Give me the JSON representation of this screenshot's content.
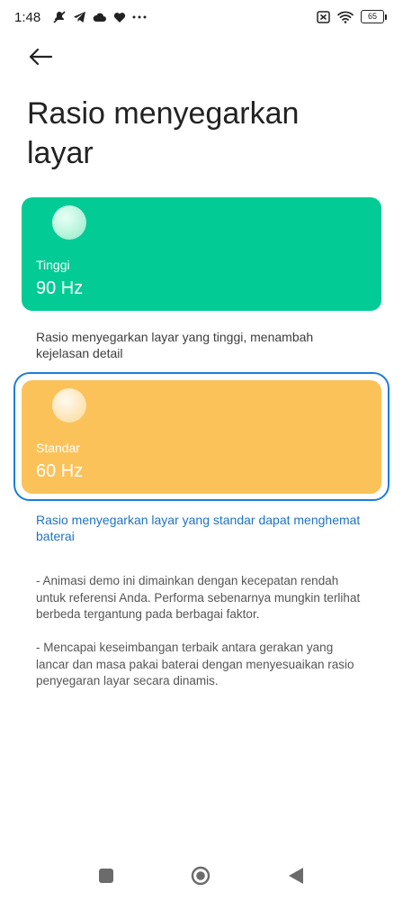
{
  "status_bar": {
    "time": "1:48",
    "left_icons": [
      "mute-icon",
      "telegram-icon",
      "cloud-icon",
      "heart-icon",
      "more-dots-icon"
    ],
    "right_icons": [
      "sim-off-icon",
      "wifi-icon"
    ],
    "battery": "65"
  },
  "header": {
    "back_icon": "arrow-left-icon",
    "title": "Rasio menyegarkan layar"
  },
  "modes": [
    {
      "label": "Tinggi",
      "value": "90 Hz",
      "color": "#03cb95",
      "description": "Rasio menyegarkan layar yang tinggi, menambah kejelasan detail",
      "selected": false
    },
    {
      "label": "Standar",
      "value": "60 Hz",
      "color": "#fbc25a",
      "description": "Rasio menyegarkan layar yang standar dapat menghemat baterai",
      "selected": true
    }
  ],
  "notes": [
    "- Animasi demo ini dimainkan dengan kecepatan rendah untuk referensi Anda. Performa sebenarnya mungkin terlihat berbeda tergantung pada berbagai faktor.",
    "- Mencapai keseimbangan terbaik antara gerakan yang lancar dan masa pakai baterai dengan menyesuaikan rasio penyegaran layar secara dinamis."
  ],
  "accent_color": "#1c7ed6",
  "nav_bar": [
    "recent-apps-icon",
    "home-icon",
    "back-triangle-icon"
  ]
}
